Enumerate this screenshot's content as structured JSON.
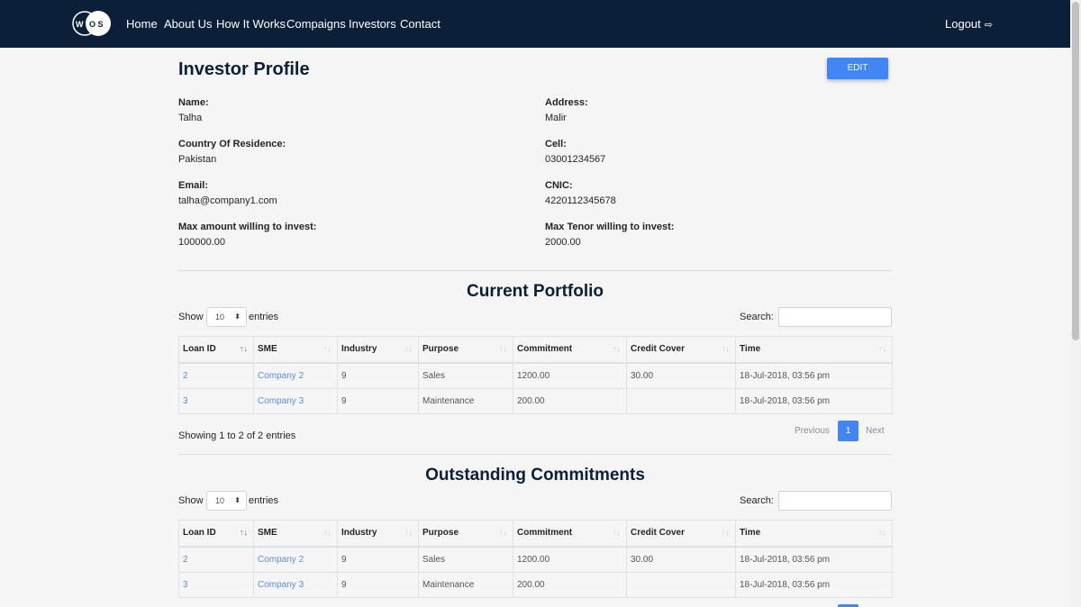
{
  "nav": {
    "logo_text": "WOS",
    "links": [
      "Home",
      "About Us",
      "How It Works",
      "Compaigns",
      "Investors",
      "Contact"
    ],
    "logout": "Logout"
  },
  "profile": {
    "title": "Investor Profile",
    "edit_label": "EDIT",
    "fields": [
      {
        "label": "Name:",
        "value": "Talha"
      },
      {
        "label": "Address:",
        "value": "Malir"
      },
      {
        "label": "Country Of Residence:",
        "value": "Pakistan"
      },
      {
        "label": "Cell:",
        "value": "03001234567"
      },
      {
        "label": "Email:",
        "value": "talha@company1.com"
      },
      {
        "label": "CNIC:",
        "value": "4220112345678"
      },
      {
        "label": "Max amount willing to invest:",
        "value": "100000.00"
      },
      {
        "label": "Max Tenor willing to invest:",
        "value": "2000.00"
      }
    ]
  },
  "portfolio": {
    "title": "Current Portfolio",
    "show_label": "Show",
    "entries_label": "entries",
    "length_value": "10",
    "search_label": "Search:",
    "columns": [
      "Loan ID",
      "SME",
      "Industry",
      "Purpose",
      "Commitment",
      "Credit Cover",
      "Time"
    ],
    "rows": [
      [
        "2",
        "Company 2",
        "9",
        "Sales",
        "1200.00",
        "30.00",
        "18-Jul-2018, 03:56 pm"
      ],
      [
        "3",
        "Company 3",
        "9",
        "Maintenance",
        "200.00",
        "",
        "18-Jul-2018, 03:56 pm"
      ]
    ],
    "info": "Showing 1 to 2 of 2 entries",
    "previous": "Previous",
    "page": "1",
    "next": "Next"
  },
  "commitments": {
    "title": "Outstanding Commitments",
    "show_label": "Show",
    "entries_label": "entries",
    "length_value": "10",
    "search_label": "Search:",
    "columns": [
      "Loan ID",
      "SME",
      "Industry",
      "Purpose",
      "Commitment",
      "Credit Cover",
      "Time"
    ],
    "rows": [
      [
        "2",
        "Company 2",
        "9",
        "Sales",
        "1200.00",
        "30.00",
        "18-Jul-2018, 03:56 pm"
      ],
      [
        "3",
        "Company 3",
        "9",
        "Maintenance",
        "200.00",
        "",
        "18-Jul-2018, 03:56 pm"
      ]
    ]
  }
}
